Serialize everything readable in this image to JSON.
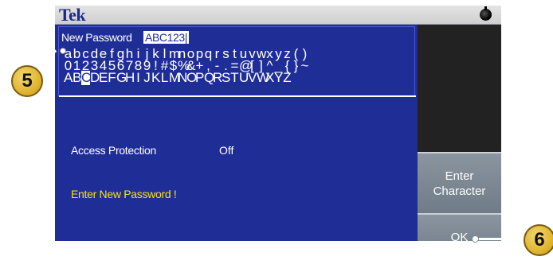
{
  "title_bar": {
    "logo": "Tek",
    "status_icon": "clock-icon"
  },
  "password": {
    "label": "New Password",
    "value": "ABC123|"
  },
  "keyboard": {
    "row1": [
      "a",
      "b",
      "c",
      "d",
      "e",
      "f",
      "g",
      "h",
      "i",
      "j",
      "k",
      "l",
      "m",
      "n",
      "o",
      "p",
      "q",
      "r",
      "s",
      "t",
      "u",
      "v",
      "w",
      "x",
      "y",
      "z",
      "(",
      ")"
    ],
    "row2": [
      "0",
      "1",
      "2",
      "3",
      "4",
      "5",
      "6",
      "7",
      "8",
      "9",
      "!",
      "#",
      "$",
      "%",
      "&",
      "+",
      ",",
      "-",
      ".",
      "=",
      "@",
      "[",
      "]",
      "^",
      "_",
      "{",
      "}",
      "~"
    ],
    "row3": [
      "A",
      "B",
      "C",
      "D",
      "E",
      "F",
      "G",
      "H",
      "I",
      "J",
      "K",
      "L",
      "M",
      "N",
      "O",
      "P",
      "Q",
      "R",
      "S",
      "T",
      "U",
      "V",
      "W",
      "X",
      "Y",
      "Z"
    ],
    "selected_row": 3,
    "selected_char": "C"
  },
  "access": {
    "label": "Access Protection",
    "value": "Off"
  },
  "message": "Enter New Password !",
  "softkeys": {
    "enter_character_line1": "Enter",
    "enter_character_line2": "Character",
    "ok": "OK"
  },
  "callouts": {
    "left": "5",
    "right": "6"
  },
  "colors": {
    "screen_blue": "#1f2e96",
    "message_yellow": "#f2e21b",
    "softkey_gray": "#7d8893",
    "callout_gold": "#e2b834"
  }
}
